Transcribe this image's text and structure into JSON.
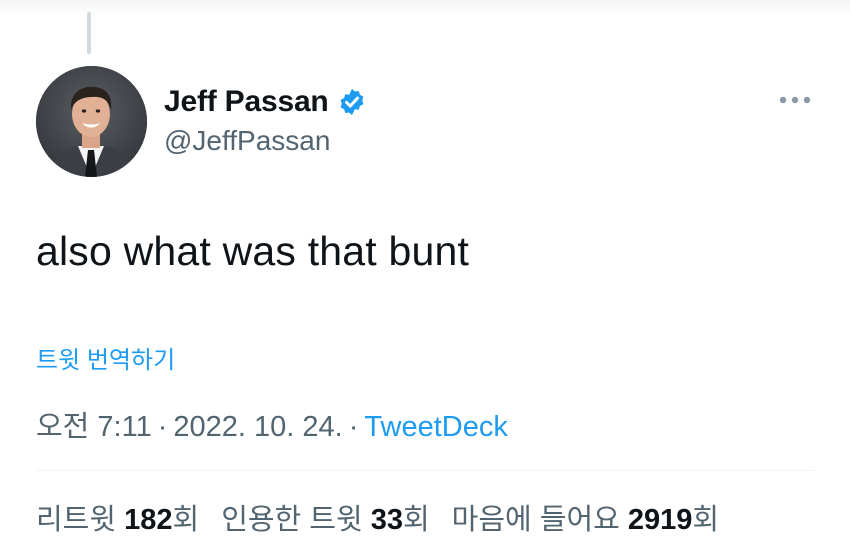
{
  "colors": {
    "accent": "#1d9bf0",
    "text_primary": "#0f1419",
    "text_secondary": "#536471",
    "divider": "#eff3f4"
  },
  "tweet": {
    "author": {
      "display_name": "Jeff Passan",
      "handle": "@JeffPassan",
      "verified": true,
      "avatar_icon": "profile-photo"
    },
    "more_icon": "ellipsis-icon",
    "text": "also what was that bunt",
    "translate_label": "트윗 번역하기",
    "meta": {
      "time": "오전 7:11",
      "separator": "·",
      "date": "2022. 10. 24.",
      "source": "TweetDeck"
    },
    "stats": {
      "retweets": {
        "label": "리트윗",
        "count": "182",
        "suffix": "회"
      },
      "quotes": {
        "label": "인용한 트윗",
        "count": "33",
        "suffix": "회"
      },
      "likes": {
        "label": "마음에 들어요",
        "count": "2919",
        "suffix": "회"
      }
    }
  }
}
